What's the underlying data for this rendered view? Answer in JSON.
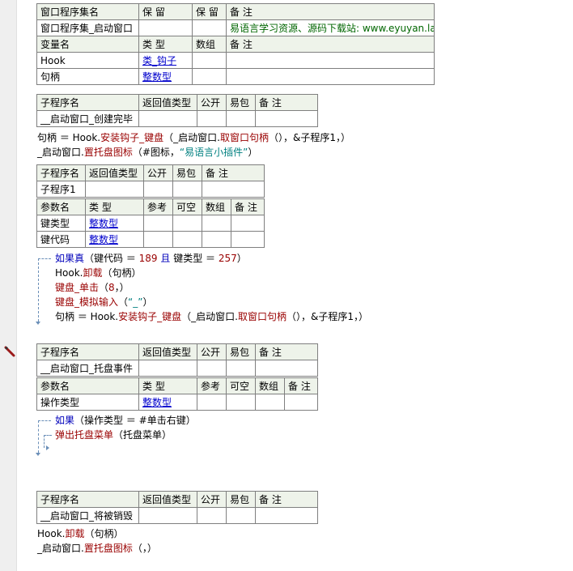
{
  "t1": {
    "h1": [
      "窗口程序集名",
      "保 留",
      "保 留",
      "备 注"
    ],
    "r1": [
      "窗口程序集_启动窗口",
      "",
      "",
      "易语言学习资源、源码下载站: www.eyuyan.la"
    ],
    "h2": [
      "变量名",
      "类 型",
      "数组",
      "备 注"
    ],
    "r2": [
      "Hook",
      "类_钩子",
      "",
      ""
    ],
    "r3": [
      "句柄",
      "整数型",
      "",
      ""
    ]
  },
  "sub_header": [
    "子程序名",
    "返回值类型",
    "公开",
    "易包",
    "备 注"
  ],
  "sub_header2": [
    "子程序名",
    "返回值类型",
    "公开",
    "易包",
    "备 注"
  ],
  "param_header": [
    "参数名",
    "类 型",
    "参考",
    "可空",
    "数组",
    "备 注"
  ],
  "s1": {
    "name": "__启动窗口_创建完毕",
    "line1": {
      "a": "句柄 ＝ Hook.",
      "b": "安装钩子_键盘",
      "c": "（_启动窗口.",
      "d": "取窗口句柄",
      "e": "（），&子程序1，）"
    },
    "line2": {
      "a": "_启动窗口.",
      "b": "置托盘图标",
      "c": "（#图标，",
      "d": "“易语言小插件”",
      "e": "）"
    }
  },
  "s2": {
    "name": "子程序1",
    "p1": [
      "键类型",
      "整数型"
    ],
    "p2": [
      "键代码",
      "整数型"
    ],
    "l1": {
      "a": "如果真",
      "b": "（键代码 ＝ ",
      "c": "189",
      "d": " 且 ",
      "e": "键类型 ＝ ",
      "f": "257",
      "g": "）"
    },
    "l2": {
      "a": "Hook.",
      "b": "卸载",
      "c": "（句柄）"
    },
    "l3": {
      "a": "键盘_单击",
      "b": "（",
      "c": "8",
      "d": "，）"
    },
    "l4": {
      "a": "键盘_模拟输入",
      "b": "（",
      "c": "“_”",
      "d": "）"
    },
    "l5": {
      "a": "句柄 ＝ Hook.",
      "b": "安装钩子_键盘",
      "c": "（_启动窗口.",
      "d": "取窗口句柄",
      "e": "（），&子程序1，）"
    }
  },
  "s3": {
    "name": "__启动窗口_托盘事件",
    "p1": [
      "操作类型",
      "整数型"
    ],
    "l1": {
      "a": "如果",
      "b": "（操作类型 ＝ #单击右键）"
    },
    "l2": {
      "a": "弹出托盘菜单",
      "b": "（托盘菜单）"
    }
  },
  "s4": {
    "name": "__启动窗口_将被销毁",
    "l1": {
      "a": "Hook.",
      "b": "卸载",
      "c": "（句柄）"
    },
    "l2": {
      "a": "_启动窗口.",
      "b": "置托盘图标",
      "c": "（，）"
    }
  },
  "icons": {
    "pencil": "pencil-icon"
  }
}
